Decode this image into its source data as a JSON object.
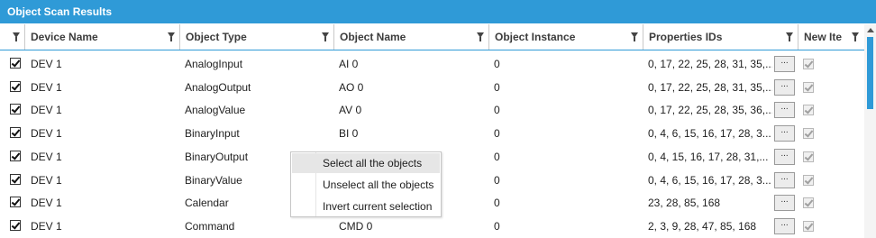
{
  "panel": {
    "title": "Object Scan Results"
  },
  "columns": {
    "device_name": "Device Name",
    "object_type": "Object Type",
    "object_name": "Object Name",
    "object_instance": "Object Instance",
    "properties_ids": "Properties IDs",
    "new_item": "New Ite"
  },
  "ellipsis_label": "...",
  "rows": [
    {
      "selected": true,
      "device": "DEV 1",
      "type": "AnalogInput",
      "name": "AI 0",
      "instance": "0",
      "props": "0, 17, 22, 25, 28, 31, 35,...",
      "new_item": true
    },
    {
      "selected": true,
      "device": "DEV 1",
      "type": "AnalogOutput",
      "name": "AO 0",
      "instance": "0",
      "props": "0, 17, 22, 25, 28, 31, 35,...",
      "new_item": true
    },
    {
      "selected": true,
      "device": "DEV 1",
      "type": "AnalogValue",
      "name": "AV 0",
      "instance": "0",
      "props": "0, 17, 22, 25, 28, 35, 36,...",
      "new_item": true
    },
    {
      "selected": true,
      "device": "DEV 1",
      "type": "BinaryInput",
      "name": "BI 0",
      "instance": "0",
      "props": "0, 4, 6, 15, 16, 17, 28, 3...",
      "new_item": true
    },
    {
      "selected": true,
      "device": "DEV 1",
      "type": "BinaryOutput",
      "name": "",
      "instance": "0",
      "props": "0, 4, 15, 16, 17, 28, 31,...",
      "new_item": true
    },
    {
      "selected": true,
      "device": "DEV 1",
      "type": "BinaryValue",
      "name": "",
      "instance": "0",
      "props": "0, 4, 6, 15, 16, 17, 28, 3...",
      "new_item": true
    },
    {
      "selected": true,
      "device": "DEV 1",
      "type": "Calendar",
      "name": "",
      "instance": "0",
      "props": "23, 28, 85, 168",
      "new_item": true
    },
    {
      "selected": true,
      "device": "DEV 1",
      "type": "Command",
      "name": "CMD 0",
      "instance": "0",
      "props": "2, 3, 9, 28, 47, 85, 168",
      "new_item": true
    }
  ],
  "context_menu": {
    "items": [
      {
        "label": "Select all the objects",
        "highlighted": true
      },
      {
        "label": "Unselect all the objects",
        "highlighted": false
      },
      {
        "label": "Invert current selection",
        "highlighted": false
      }
    ]
  },
  "colors": {
    "accent": "#2f9ad7",
    "header_border": "#2f9ad7"
  }
}
